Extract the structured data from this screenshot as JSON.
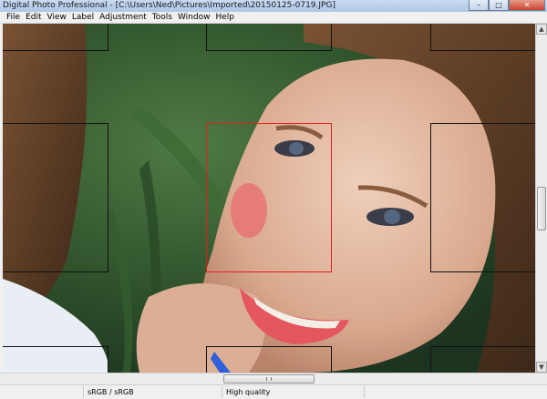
{
  "window": {
    "title": "Digital Photo Professional - [C:\\Users\\Ned\\Pictures\\Imported\\20150125-0719.JPG]",
    "minimize_label": "–",
    "maximize_label": "□",
    "close_label": "✕"
  },
  "menu": [
    {
      "label": "File"
    },
    {
      "label": "Edit"
    },
    {
      "label": "View"
    },
    {
      "label": "Label"
    },
    {
      "label": "Adjustment"
    },
    {
      "label": "Tools"
    },
    {
      "label": "Window"
    },
    {
      "label": "Help"
    }
  ],
  "scrollbars": {
    "up_arrow": "▲",
    "down_arrow": "▼"
  },
  "status": {
    "color_space": "sRGB / sRGB",
    "quality": "High quality"
  },
  "colors": {
    "active_af_point": "#e02020",
    "af_point": "#111111"
  }
}
